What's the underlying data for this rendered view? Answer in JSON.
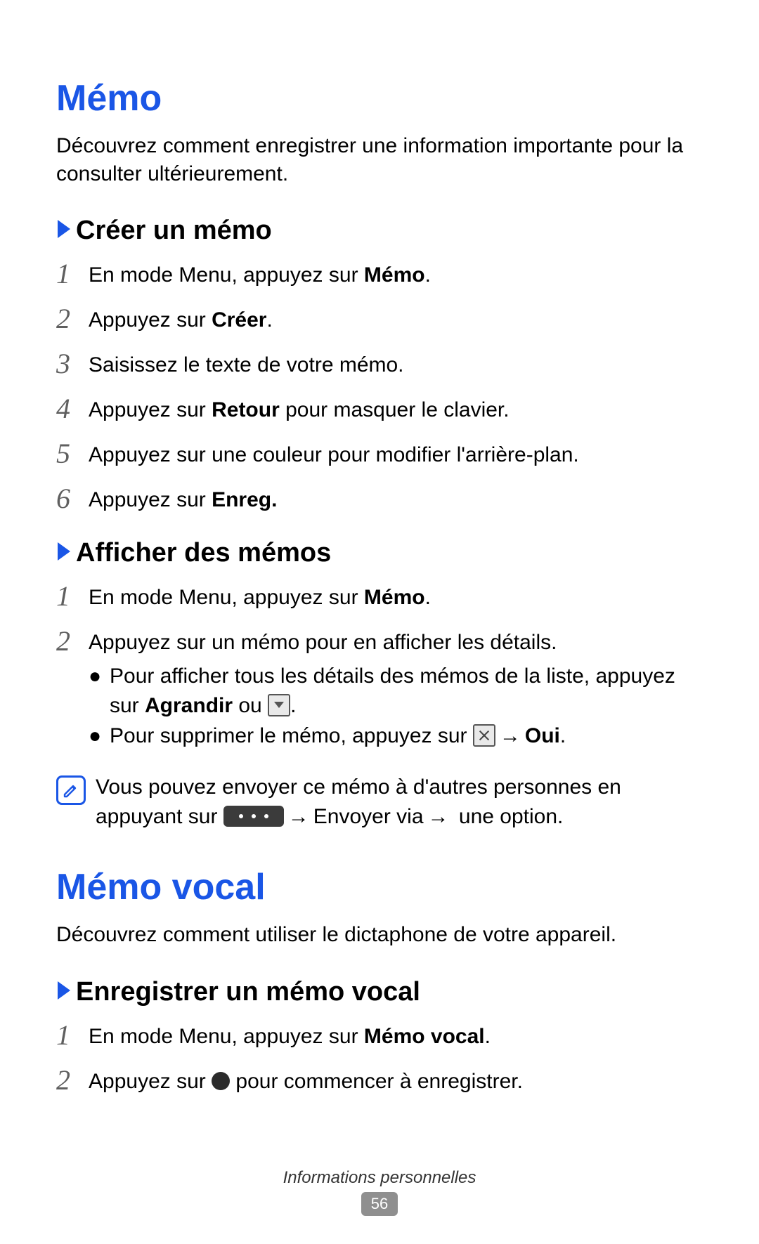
{
  "section1": {
    "title": "Mémo",
    "intro": "Découvrez comment enregistrer une information importante pour la consulter ultérieurement."
  },
  "sub1": {
    "title": "Créer un mémo",
    "steps": {
      "s1a": "En mode Menu, appuyez sur ",
      "s1b": "Mémo",
      "s1c": ".",
      "s2a": "Appuyez sur ",
      "s2b": "Créer",
      "s2c": ".",
      "s3": "Saisissez le texte de votre mémo.",
      "s4a": "Appuyez sur ",
      "s4b": "Retour",
      "s4c": "  pour masquer le clavier.",
      "s5": "Appuyez sur une couleur pour modifier l'arrière-plan.",
      "s6a": "Appuyez sur ",
      "s6b": "Enreg."
    },
    "nums": {
      "n1": "1",
      "n2": "2",
      "n3": "3",
      "n4": "4",
      "n5": "5",
      "n6": "6"
    }
  },
  "sub2": {
    "title": "Afficher des mémos",
    "steps": {
      "s1a": "En mode Menu, appuyez sur ",
      "s1b": "Mémo",
      "s1c": ".",
      "s2": "Appuyez sur un mémo pour en afficher les détails."
    },
    "nums": {
      "n1": "1",
      "n2": "2"
    },
    "bullets": {
      "b1a": "Pour afficher tous les détails des mémos de la liste, appuyez sur ",
      "b1b": "Agrandir",
      "b1c": " ou ",
      "b1d": ".",
      "b2a": "Pour supprimer le mémo, appuyez sur ",
      "b2arrow": "→",
      "b2c": "Oui",
      "b2d": "."
    },
    "note": {
      "t1": "Vous pouvez envoyer ce mémo à d'autres personnes en appuyant sur ",
      "arrow1": "→",
      "t2": "Envoyer via",
      "arrow2": "→",
      "t3": " une option."
    }
  },
  "section2": {
    "title": "Mémo vocal",
    "intro": "Découvrez comment utiliser le dictaphone de votre appareil."
  },
  "sub3": {
    "title": "Enregistrer un mémo vocal",
    "steps": {
      "s1a": "En mode Menu, appuyez sur ",
      "s1b": "Mémo vocal",
      "s1c": ".",
      "s2a": "Appuyez sur ",
      "s2b": " pour commencer à enregistrer."
    },
    "nums": {
      "n1": "1",
      "n2": "2"
    }
  },
  "footer": {
    "chapter": "Informations personnelles",
    "page": "56"
  },
  "bullet_glyph": "●"
}
